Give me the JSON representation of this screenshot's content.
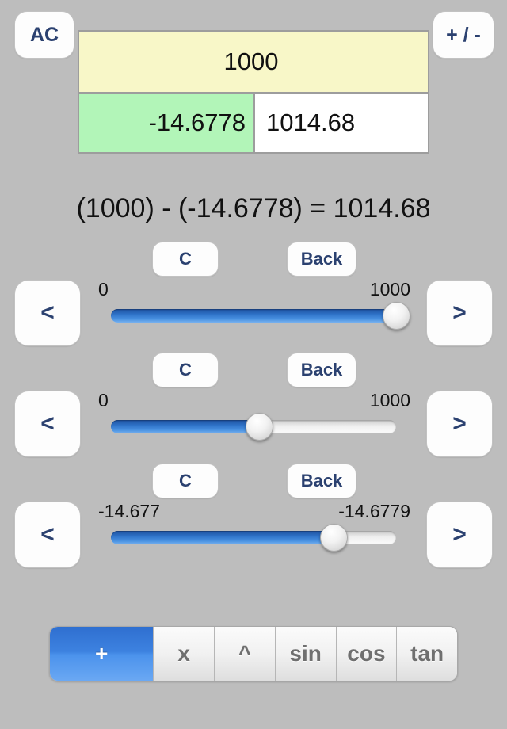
{
  "top_keys": {
    "all_clear_label": "AC",
    "sign_toggle_label": "+ / -"
  },
  "display": {
    "operand1": "1000",
    "operand2": "-14.6778",
    "result": "1014.68",
    "operand1_bg": "#f8f7c8",
    "operand2_bg": "#b2f5b8",
    "result_bg": "#ffffff"
  },
  "equation": "(1000) - (-14.6778) = 1014.68",
  "common": {
    "clear_label": "C",
    "back_label": "Back",
    "arrow_left_label": "<",
    "arrow_right_label": ">"
  },
  "sliders": [
    {
      "min_label": "0",
      "max_label": "1000",
      "value_percent": 100,
      "fill_color": "#3d82e0"
    },
    {
      "min_label": "0",
      "max_label": "1000",
      "value_percent": 52,
      "fill_color": "#3d82e0"
    },
    {
      "min_label": "-14.677",
      "max_label": "-14.6779",
      "value_percent": 78,
      "fill_color": "#3d82e0"
    }
  ],
  "operators": {
    "selected_index": 0,
    "selected_color": "#3d82e0",
    "items": [
      {
        "label": "+"
      },
      {
        "label": "x"
      },
      {
        "label": "^"
      },
      {
        "label": "sin"
      },
      {
        "label": "cos"
      },
      {
        "label": "tan"
      }
    ]
  }
}
